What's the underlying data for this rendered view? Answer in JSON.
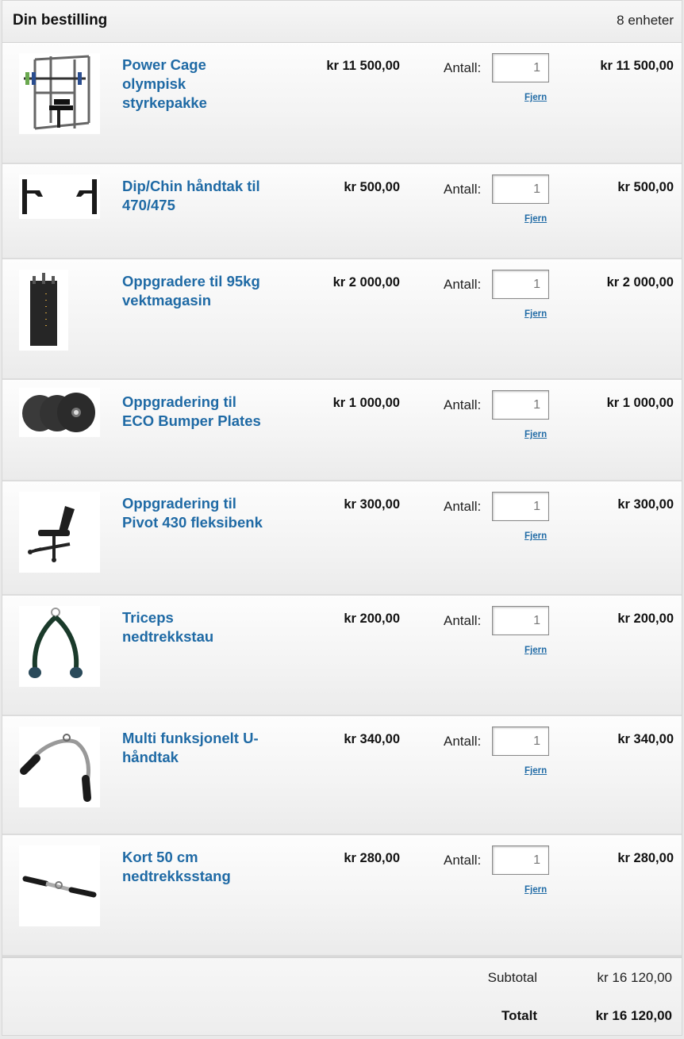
{
  "header": {
    "title": "Din bestilling",
    "count": "8 enheter"
  },
  "labels": {
    "quantity": "Antall:",
    "remove": "Fjern"
  },
  "items": [
    {
      "name": "Power Cage olympisk styrkepakke",
      "price": "kr 11 500,00",
      "qty": "1",
      "total": "kr 11 500,00",
      "icon": "power-cage-image"
    },
    {
      "name": "Dip/Chin håndtak til 470/475",
      "price": "kr 500,00",
      "qty": "1",
      "total": "kr 500,00",
      "icon": "dip-handle-image"
    },
    {
      "name": "Oppgradere til 95kg vektmagasin",
      "price": "kr 2 000,00",
      "qty": "1",
      "total": "kr 2 000,00",
      "icon": "weight-stack-image"
    },
    {
      "name": "Oppgradering til ECO Bumper Plates",
      "price": "kr 1 000,00",
      "qty": "1",
      "total": "kr 1 000,00",
      "icon": "bumper-plates-image"
    },
    {
      "name": "Oppgradering til Pivot 430 fleksibenk",
      "price": "kr 300,00",
      "qty": "1",
      "total": "kr 300,00",
      "icon": "bench-image"
    },
    {
      "name": "Triceps nedtrekkstau",
      "price": "kr 200,00",
      "qty": "1",
      "total": "kr 200,00",
      "icon": "triceps-rope-image"
    },
    {
      "name": "Multi funksjonelt U-håndtak",
      "price": "kr 340,00",
      "qty": "1",
      "total": "kr 340,00",
      "icon": "u-handle-image"
    },
    {
      "name": "Kort 50 cm nedtrekksstang",
      "price": "kr 280,00",
      "qty": "1",
      "total": "kr 280,00",
      "icon": "pulldown-bar-image"
    }
  ],
  "summary": {
    "subtotal_label": "Subtotal",
    "subtotal_value": "kr 16 120,00",
    "total_label": "Totalt",
    "total_value": "kr 16 120,00"
  },
  "colors": {
    "link": "#1f6aa5",
    "text": "#222222",
    "background": "#fafafa"
  }
}
